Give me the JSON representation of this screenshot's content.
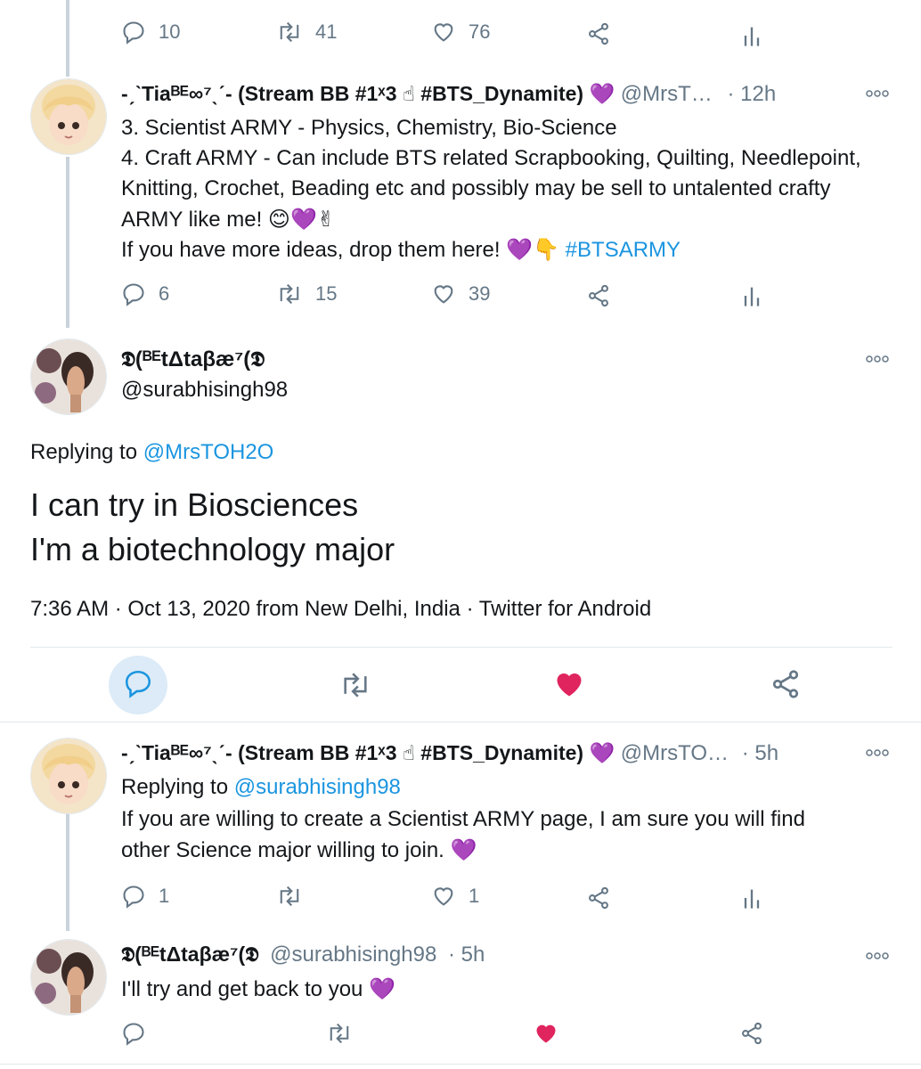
{
  "top_tweet": {
    "replies": "10",
    "retweets": "41",
    "likes": "76"
  },
  "tweet1": {
    "display_name": "-ˏˋTiaᴮᴱ∞⁷ˎˊ- (Stream BB #1ˣ3 ☝ #BTS_Dynamite) 💜",
    "handle": "@MrsT…",
    "time": "· 12h",
    "lines": [
      "3. Scientist ARMY - Physics, Chemistry, Bio-Science",
      "4. Craft ARMY - Can include BTS related Scrapbooking, Quilting, Needlepoint,",
      "Knitting, Crochet, Beading etc and possibly may be sell to untalented crafty",
      "ARMY like me! 😊💜✌"
    ],
    "last_line_text": "If you have more ideas, drop them here! 💜👇 ",
    "hashtag": "#BTSARMY",
    "replies": "6",
    "retweets": "15",
    "likes": "39"
  },
  "main_tweet": {
    "display_name": "𝕯(ᴮᴱtΔtaβæ⁷(𝕯",
    "handle": "@surabhisingh98",
    "replying_prefix": "Replying to ",
    "replying_handle": "@MrsTOH2O",
    "text_line1": "I can try in Biosciences",
    "text_line2": "I'm a biotechnology major",
    "meta": "7:36 AM · Oct 13, 2020 from New Delhi, India · Twitter for Android"
  },
  "tweet2": {
    "display_name": "-ˏˋTiaᴮᴱ∞⁷ˎˊ- (Stream BB #1ˣ3 ☝ #BTS_Dynamite) 💜",
    "handle": "@MrsTO…",
    "time": "· 5h",
    "replying_prefix": "Replying to ",
    "replying_handle": "@surabhisingh98",
    "line1": "If you are willing to create a Scientist ARMY page, I am sure you will find",
    "line2": "other Science major willing to join. 💜",
    "replies": "1",
    "retweets": "",
    "likes": "1"
  },
  "tweet3": {
    "display_name": "𝕯(ᴮᴱtΔtaβæ⁷(𝕯",
    "handle": "@surabhisingh98",
    "time": "· 5h",
    "text": "I'll try and get back to you 💜"
  },
  "colors": {
    "accent": "#1b95e0",
    "like_red": "#e0245e",
    "icon_gray": "#657786",
    "thread_line": "#c9d3db"
  }
}
